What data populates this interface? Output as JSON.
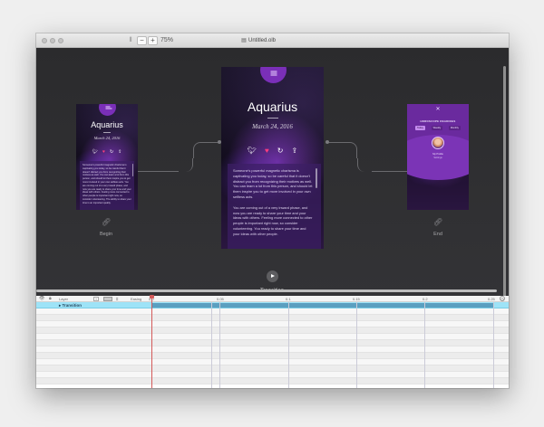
{
  "window": {
    "zoom_out_label": "−",
    "zoom_in_label": "+",
    "zoom_level": "75%",
    "doc_title": "Untitled.olb"
  },
  "screens": {
    "begin": {
      "title": "Aquarius",
      "date": "March 24, 2016",
      "body": "Someone's powerful magnetic charisma is captivating you today, so be careful that it doesn't distract you from recognizing their motives as well. You can learn a lot from this person, and should let them inspire you to get more involved in your own selfless acts. You are coming out of a very inward phase, and now you are ready to share your time and your ideas with others. Feeling more connected to other people is important right now, so consider volunteering. The ability to share your time is an important quality.",
      "caption": "Begin"
    },
    "transition": {
      "title": "Aquarius",
      "date": "March 24, 2016",
      "para1": "Someone's powerful magnetic charisma is captivating you today, so be careful that it doesn't distract you from recognizing their motives as well. You can learn a lot from this person, and should let them inspire you to get more involved in your own selfless acts.",
      "para2": "You are coming out of a very inward phase, and now you are ready to share your time and your ideas with others. Feeling more connected to other people is important right now, so consider volunteering. You ready to share your time and your ideas with other people.",
      "caption": "Transition"
    },
    "end": {
      "title": "HOROSCOPE READINGS",
      "tabs": [
        "Today",
        "Weekly",
        "Monthly"
      ],
      "profile_name": "My Profile",
      "settings_label": "Settings",
      "caption": "End"
    }
  },
  "timeline": {
    "layer_label": "Layer",
    "easing_label": "Easing",
    "ticks": [
      "0.0",
      "0.05",
      "0.1",
      "0.15",
      "0.2",
      "0.25"
    ],
    "row_label": "Transition"
  },
  "colors": {
    "accent_purple": "#7a2fb8",
    "heart": "#ff3d7f",
    "selected_row": "#9ee3f7",
    "transition_bar": "#5b9fc0",
    "playhead": "#d45a5a"
  },
  "icons": [
    "twitter-icon",
    "heart-icon",
    "refresh-icon",
    "share-icon",
    "link-icon",
    "play-icon",
    "eye-icon",
    "lock-icon",
    "close-icon",
    "menu-icon"
  ]
}
